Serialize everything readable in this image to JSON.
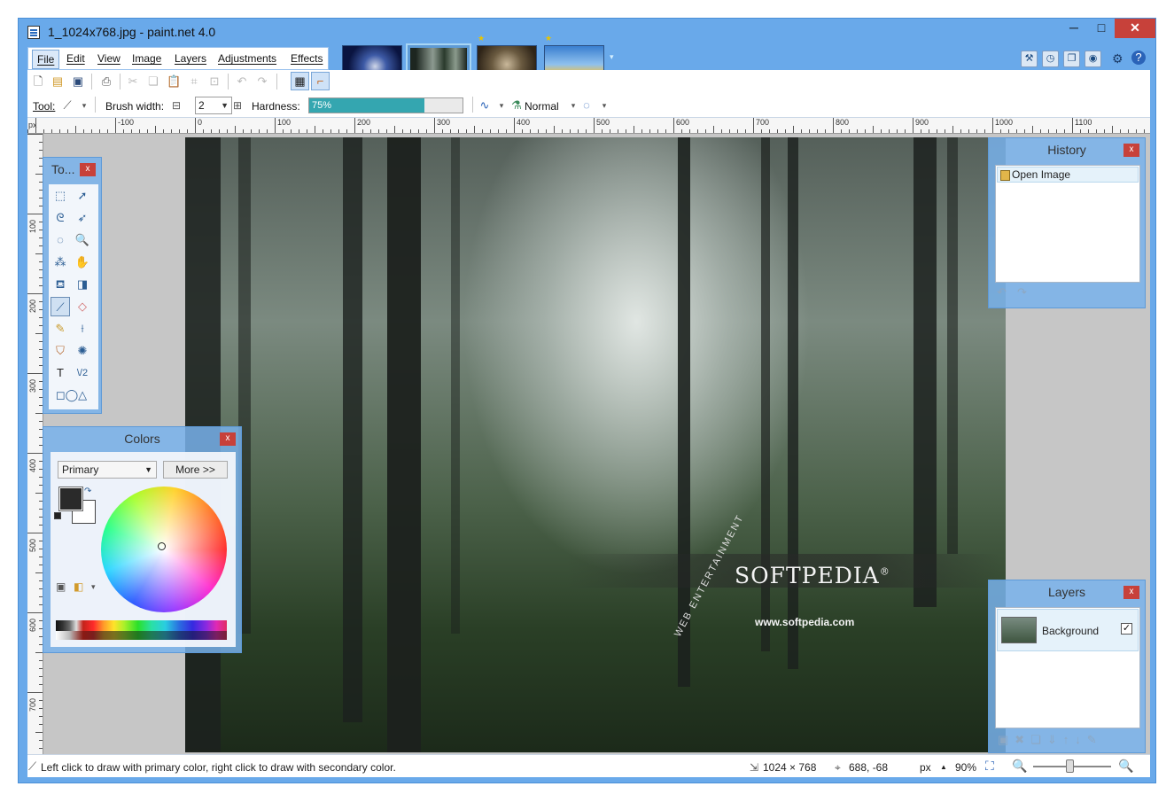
{
  "window": {
    "title": "1_1024x768.jpg - paint.net 4.0"
  },
  "menu": {
    "items": [
      "File",
      "Edit",
      "View",
      "Image",
      "Layers",
      "Adjustments",
      "Effects"
    ]
  },
  "toolbar": {
    "tool_label": "Tool:",
    "brush_width_label": "Brush width:",
    "brush_width_value": "2",
    "hardness_label": "Hardness:",
    "hardness_value": "75%",
    "hardness_fraction": 0.75,
    "blend_mode": "Normal"
  },
  "rulers": {
    "unit": "px",
    "h_labels": [
      "-100",
      "0",
      "100",
      "200",
      "300",
      "400",
      "500",
      "600",
      "700",
      "800",
      "900",
      "1000",
      "1100"
    ],
    "v_labels": [
      "100",
      "200",
      "300",
      "400",
      "500",
      "600",
      "700"
    ]
  },
  "canvas": {
    "watermark": "SOFTPEDIA",
    "watermark_mark": "®",
    "watermark_url": "www.softpedia.com",
    "watermark_arc": "WEB ENTERTAINMENT"
  },
  "tools_panel": {
    "title": "To..."
  },
  "colors_panel": {
    "title": "Colors",
    "mode": "Primary",
    "more_button": "More >>",
    "primary_color": "#2a2a2a",
    "secondary_color": "#ffffff"
  },
  "history_panel": {
    "title": "History",
    "items": [
      "Open Image"
    ]
  },
  "layers_panel": {
    "title": "Layers",
    "layers": [
      {
        "name": "Background",
        "visible": true
      }
    ]
  },
  "status": {
    "hint": "Left click to draw with primary color, right click to draw with secondary color.",
    "image_size": "1024 × 768",
    "cursor_pos": "688, -68",
    "units": "px",
    "zoom": "90%"
  },
  "colors": {
    "accent": "#69a9ea",
    "close": "#c7413a",
    "hardness": "#34a6b0"
  }
}
